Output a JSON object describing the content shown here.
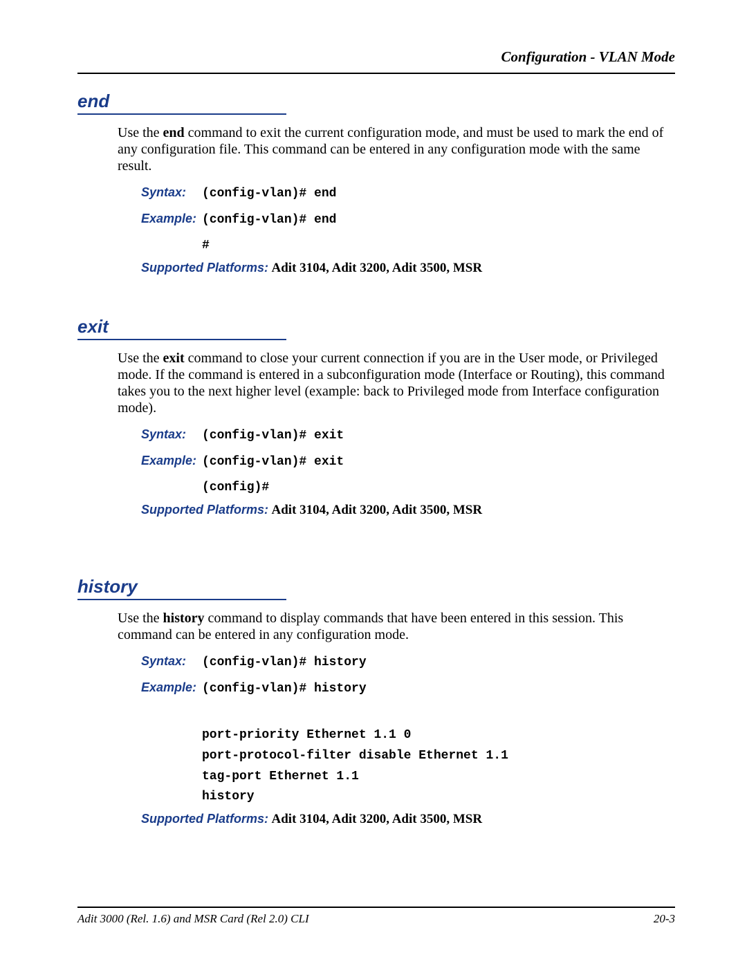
{
  "header": {
    "running_title": "Configuration - VLAN Mode"
  },
  "sections": [
    {
      "heading": "end",
      "body_html": "Use the <b>end</b> command to exit the current configuration mode, and must be used to mark the end of any configuration file. This command can be entered in any configuration mode with the same result.",
      "syntax_label": "Syntax:",
      "syntax_value": "(config-vlan)# end",
      "example_label": "Example:",
      "example_value": "(config-vlan)# end",
      "example_output": "#",
      "platforms_label": "Supported Platforms:",
      "platforms_value": " Adit 3104, Adit 3200, Adit 3500, MSR"
    },
    {
      "heading": "exit",
      "body_html": "Use the <b>exit</b> command to close your current connection if you are in the User mode, or Privileged mode. If the command is entered in a subconfiguration mode (Interface or Routing), this command takes you to the next higher level (example: back to Privileged mode from Interface configuration mode).",
      "syntax_label": "Syntax:",
      "syntax_value": "(config-vlan)# exit",
      "example_label": "Example:",
      "example_value": "(config-vlan)# exit",
      "example_output": "(config)#",
      "platforms_label": "Supported Platforms:",
      "platforms_value": " Adit 3104, Adit 3200, Adit 3500, MSR"
    },
    {
      "heading": "history",
      "body_html": "Use the <b>history</b> command to display commands that have been entered in this session.  This command can be entered in any configuration mode.",
      "syntax_label": "Syntax:",
      "syntax_value": "(config-vlan)# history",
      "example_label": "Example:",
      "example_value": "(config-vlan)# history",
      "example_output": "\nport-priority Ethernet 1.1 0\nport-protocol-filter disable Ethernet 1.1\ntag-port Ethernet 1.1\nhistory",
      "platforms_label": "Supported Platforms:",
      "platforms_value": " Adit 3104, Adit 3200, Adit 3500, MSR"
    }
  ],
  "footer": {
    "left": "Adit 3000 (Rel. 1.6) and MSR Card (Rel 2.0) CLI",
    "right": "20-3"
  }
}
